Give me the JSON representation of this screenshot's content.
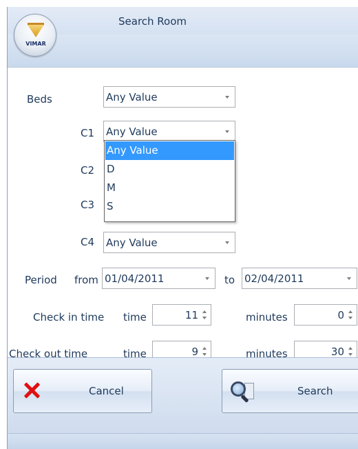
{
  "window": {
    "title": "Search Room",
    "logo_text": "VIMAR"
  },
  "form": {
    "beds": {
      "label": "Beds",
      "value": "Any Value"
    },
    "c1": {
      "label": "C1",
      "value": "Any Value"
    },
    "c2": {
      "label": "C2"
    },
    "c3": {
      "label": "C3"
    },
    "c4": {
      "label": "C4",
      "value": "Any Value"
    },
    "c1_dropdown_options": [
      "Any Value",
      "D",
      "M",
      "S"
    ],
    "period": {
      "label": "Period",
      "from_label": "from",
      "from_value": "01/04/2011",
      "to_label": "to",
      "to_value": "02/04/2011"
    },
    "check_in": {
      "label": "Check in time",
      "time_label": "time",
      "time_value": "11",
      "minutes_label": "minutes",
      "minutes_value": "0"
    },
    "check_out": {
      "label": "Check out time",
      "time_label": "time",
      "time_value": "9",
      "minutes_label": "minutes",
      "minutes_value": "30"
    }
  },
  "buttons": {
    "cancel_label": "Cancel",
    "search_label": "Search"
  },
  "icons": {
    "cancel": "close-x-icon",
    "search": "magnifier-search-icon",
    "logo": "vimar-logo-icon"
  },
  "colors": {
    "selection": "#3399ff",
    "cancel_x": "#e01010",
    "text": "#1e395b"
  }
}
